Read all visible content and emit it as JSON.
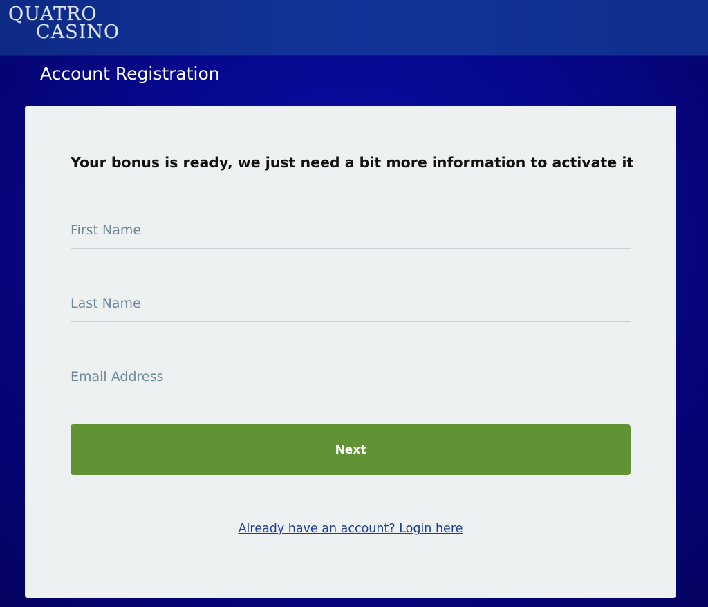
{
  "header": {
    "logo_line1": "QUATRO",
    "logo_line2": "CASINO"
  },
  "page": {
    "title": "Account Registration"
  },
  "form": {
    "heading": "Your bonus is ready, we just need a bit more information to activate it",
    "first_name_placeholder": "First Name",
    "last_name_placeholder": "Last Name",
    "email_placeholder": "Email Address",
    "next_label": "Next",
    "login_link": "Already have an account? Login here"
  },
  "colors": {
    "background": "#07088f",
    "header_bar": "#12349a",
    "card": "#eef1f2",
    "button": "#619335",
    "link": "#1f3e91"
  }
}
